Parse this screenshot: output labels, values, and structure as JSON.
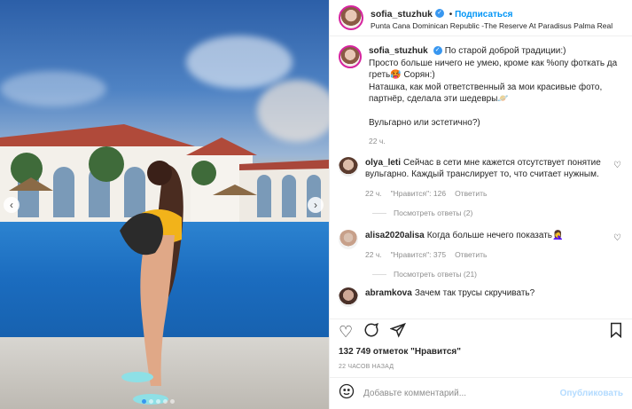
{
  "header": {
    "username": "sofia_stuzhuk",
    "follow_label": "Подписаться",
    "location": "Punta Cana Dominican Republic -The Reserve At Paradisus Palma Real"
  },
  "caption": {
    "username": "sofia_stuzhuk",
    "lines": [
      "По старой доброй традиции:)",
      "Просто больше ничего не умею, кроме как %опу фоткать да греть🥵 Сорян:)",
      "Наташка, как мой ответственный за мои красивые фото, партнёр, сделала эти шедевры🪐",
      "",
      "Вульгарно или эстетично?)"
    ],
    "time": "22 ч."
  },
  "comments": [
    {
      "username": "olya_leti",
      "text": "Сейчас в сети мне кажется отсутствует понятие вульгарно. Каждый транслирует то, что считает нужным.",
      "time": "22 ч.",
      "likes": "\"Нравится\": 126",
      "reply": "Ответить",
      "view_replies": "Посмотреть ответы (2)"
    },
    {
      "username": "alisa2020alisa",
      "text": "Когда больше нечего показать🤦‍♀️",
      "time": "22 ч.",
      "likes": "\"Нравится\": 375",
      "reply": "Ответить",
      "view_replies": "Посмотреть ответы (21)"
    },
    {
      "username": "abramkova",
      "text": "Зачем так трусы скручивать?"
    }
  ],
  "footer": {
    "likes_text": "132 749 отметок \"Нравится\"",
    "timestamp": "22 ЧАСОВ НАЗАД",
    "comment_placeholder": "Добавьте комментарий...",
    "publish_label": "Опубликовать"
  },
  "icons": {
    "like": "heart-icon",
    "comment": "comment-icon",
    "share": "paper-plane-icon",
    "save": "bookmark-icon",
    "emoji": "smiley-icon"
  },
  "colors": {
    "accent": "#0095f6",
    "verified": "#3897f0",
    "muted": "#8e8e8e"
  }
}
